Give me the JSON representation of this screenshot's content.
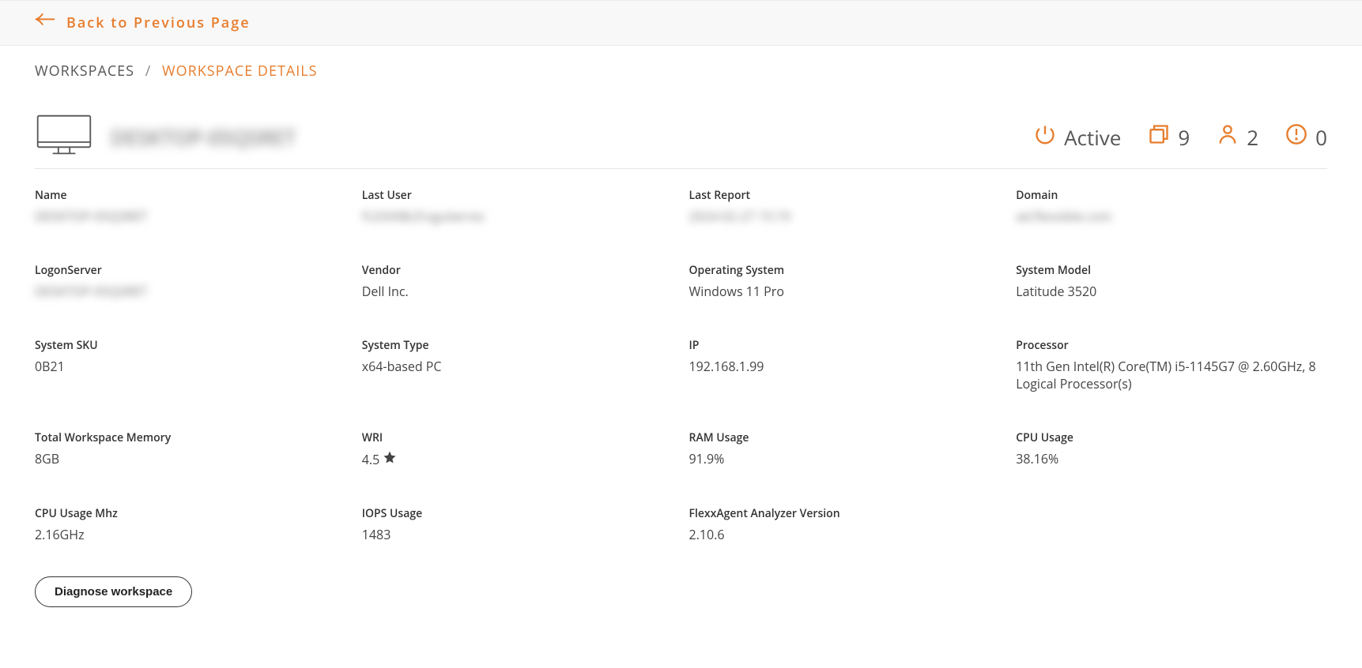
{
  "nav": {
    "back_label": "Back to Previous Page"
  },
  "breadcrumb": {
    "root": "WORKSPACES",
    "current": "WORKSPACE DETAILS"
  },
  "header": {
    "title": "DESKTOP-05QSRET",
    "status": "Active",
    "sessions_count": "9",
    "users_count": "2",
    "alerts_count": "0"
  },
  "fields": {
    "name": {
      "label": "Name",
      "value": "DESKTOP-05QSRET",
      "blur": true
    },
    "last_user": {
      "label": "Last User",
      "value": "FLEXXIBLE\\rgutierrez",
      "blur": true
    },
    "last_report": {
      "label": "Last Report",
      "value": "2024-02-27 15:19",
      "blur": true
    },
    "domain": {
      "label": "Domain",
      "value": "ad.flexxible.com",
      "blur": true
    },
    "logon_server": {
      "label": "LogonServer",
      "value": "DESKTOP-05QSRET",
      "blur": true
    },
    "vendor": {
      "label": "Vendor",
      "value": "Dell Inc."
    },
    "os": {
      "label": "Operating System",
      "value": "Windows 11 Pro"
    },
    "system_model": {
      "label": "System Model",
      "value": "Latitude 3520"
    },
    "system_sku": {
      "label": "System SKU",
      "value": "0B21"
    },
    "system_type": {
      "label": "System Type",
      "value": "x64-based PC"
    },
    "ip": {
      "label": "IP",
      "value": "192.168.1.99"
    },
    "processor": {
      "label": "Processor",
      "value": "11th Gen Intel(R) Core(TM) i5-1145G7 @ 2.60GHz, 8 Logical Processor(s)"
    },
    "total_memory": {
      "label": "Total Workspace Memory",
      "value": "8GB"
    },
    "wri": {
      "label": "WRI",
      "value": "4.5"
    },
    "ram_usage": {
      "label": "RAM Usage",
      "value": "91.9%"
    },
    "cpu_usage": {
      "label": "CPU Usage",
      "value": "38.16%"
    },
    "cpu_usage_mhz": {
      "label": "CPU Usage Mhz",
      "value": "2.16GHz"
    },
    "iops_usage": {
      "label": "IOPS Usage",
      "value": "1483"
    },
    "analyzer_version": {
      "label": "FlexxAgent Analyzer Version",
      "value": "2.10.6"
    }
  },
  "actions": {
    "diagnose_label": "Diagnose workspace"
  }
}
